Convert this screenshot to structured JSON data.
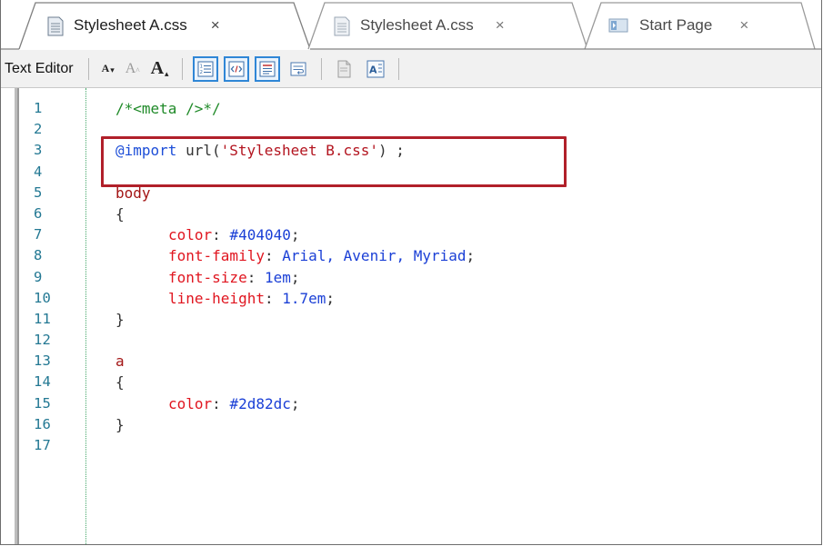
{
  "tabs": [
    {
      "title": "Stylesheet A.css",
      "close": "×",
      "icon": "css-file-icon",
      "active": true
    },
    {
      "title": "Stylesheet A.css",
      "close": "×",
      "icon": "css-file-icon",
      "active": false
    },
    {
      "title": "Start Page",
      "close": "×",
      "icon": "start-page-icon",
      "active": false
    }
  ],
  "toolbar": {
    "label": "Text Editor",
    "font_decrease": "A",
    "font_reset": "A",
    "font_increase": "A"
  },
  "line_numbers": [
    "1",
    "2",
    "3",
    "4",
    "5",
    "6",
    "7",
    "8",
    "9",
    "10",
    "11",
    "12",
    "13",
    "14",
    "15",
    "16",
    "17"
  ],
  "code": {
    "l1": "/*<meta />*/",
    "l3_at": "@import",
    "l3_fn": " url(",
    "l3_str": "'Stylesheet B.css'",
    "l3_end": ") ;",
    "l5": "body",
    "l6": "{",
    "l7_prop": "color",
    "l7_val": "#404040",
    "l8_prop": "font-family",
    "l8_val": "Arial, Avenir, Myriad",
    "l9_prop": "font-size",
    "l9_val": "1em",
    "l10_prop": "line-height",
    "l10_val": "1.7em",
    "l11": "}",
    "l13": "a",
    "l14": "{",
    "l15_prop": "color",
    "l15_val": "#2d82dc",
    "l16": "}"
  },
  "colors": {
    "highlight_border": "#b1202a",
    "active_toggle": "#2f86d6"
  }
}
